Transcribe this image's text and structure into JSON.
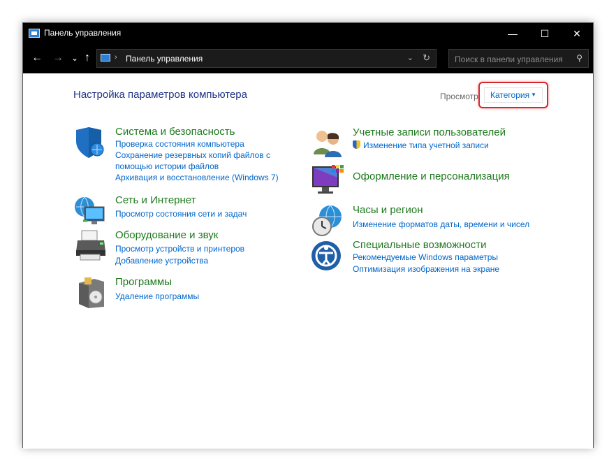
{
  "window": {
    "title": "Панель управления",
    "controls": {
      "minimize": "—",
      "maximize": "☐",
      "close": "✕"
    }
  },
  "nav": {
    "back": "←",
    "forward": "→",
    "recent": "⌄",
    "up": "↑",
    "address_separator": "›",
    "address_path": "Панель управления",
    "address_dropdown": "⌄",
    "refresh": "↻",
    "search_placeholder": "Поиск в панели управления",
    "search_icon_glyph": "⚲"
  },
  "main": {
    "heading": "Настройка параметров компьютера",
    "view_label": "Просмотр:",
    "view_value": "Категория",
    "view_caret": "▼",
    "left_categories": [
      {
        "title": "Система и безопасность",
        "icon": "shield-icon",
        "links": [
          "Проверка состояния компьютера",
          "Сохранение резервных копий файлов с",
          "помощью истории файлов",
          "Архивация и восстановление (Windows 7)"
        ]
      },
      {
        "title": "Сеть и Интернет",
        "icon": "network-globe-icon",
        "links": [
          "Просмотр состояния сети и задач"
        ]
      },
      {
        "title": "Оборудование и звук",
        "icon": "printer-icon",
        "links": [
          "Просмотр устройств и принтеров",
          "Добавление устройства"
        ]
      },
      {
        "title": "Программы",
        "icon": "programs-disc-icon",
        "links": [
          "Удаление программы"
        ]
      }
    ],
    "right_categories": [
      {
        "title": "Учетные записи пользователей",
        "icon": "users-icon",
        "links": [
          "Изменение типа учетной записи"
        ]
      },
      {
        "title": "Оформление и персонализация",
        "icon": "monitor-palette-icon",
        "links": []
      },
      {
        "title": "Часы и регион",
        "icon": "clock-globe-icon",
        "links": [
          "Изменение форматов даты, времени и чисел"
        ]
      },
      {
        "title": "Специальные возможности",
        "icon": "accessibility-icon",
        "links": [
          "Рекомендуемые Windows параметры",
          "Оптимизация изображения на экране"
        ]
      }
    ]
  },
  "colors": {
    "titlebar_bg": "#000000",
    "category_title": "#1e7a1e",
    "link": "#0066cc",
    "heading": "#1e3287",
    "highlight_border": "#d9272e"
  }
}
